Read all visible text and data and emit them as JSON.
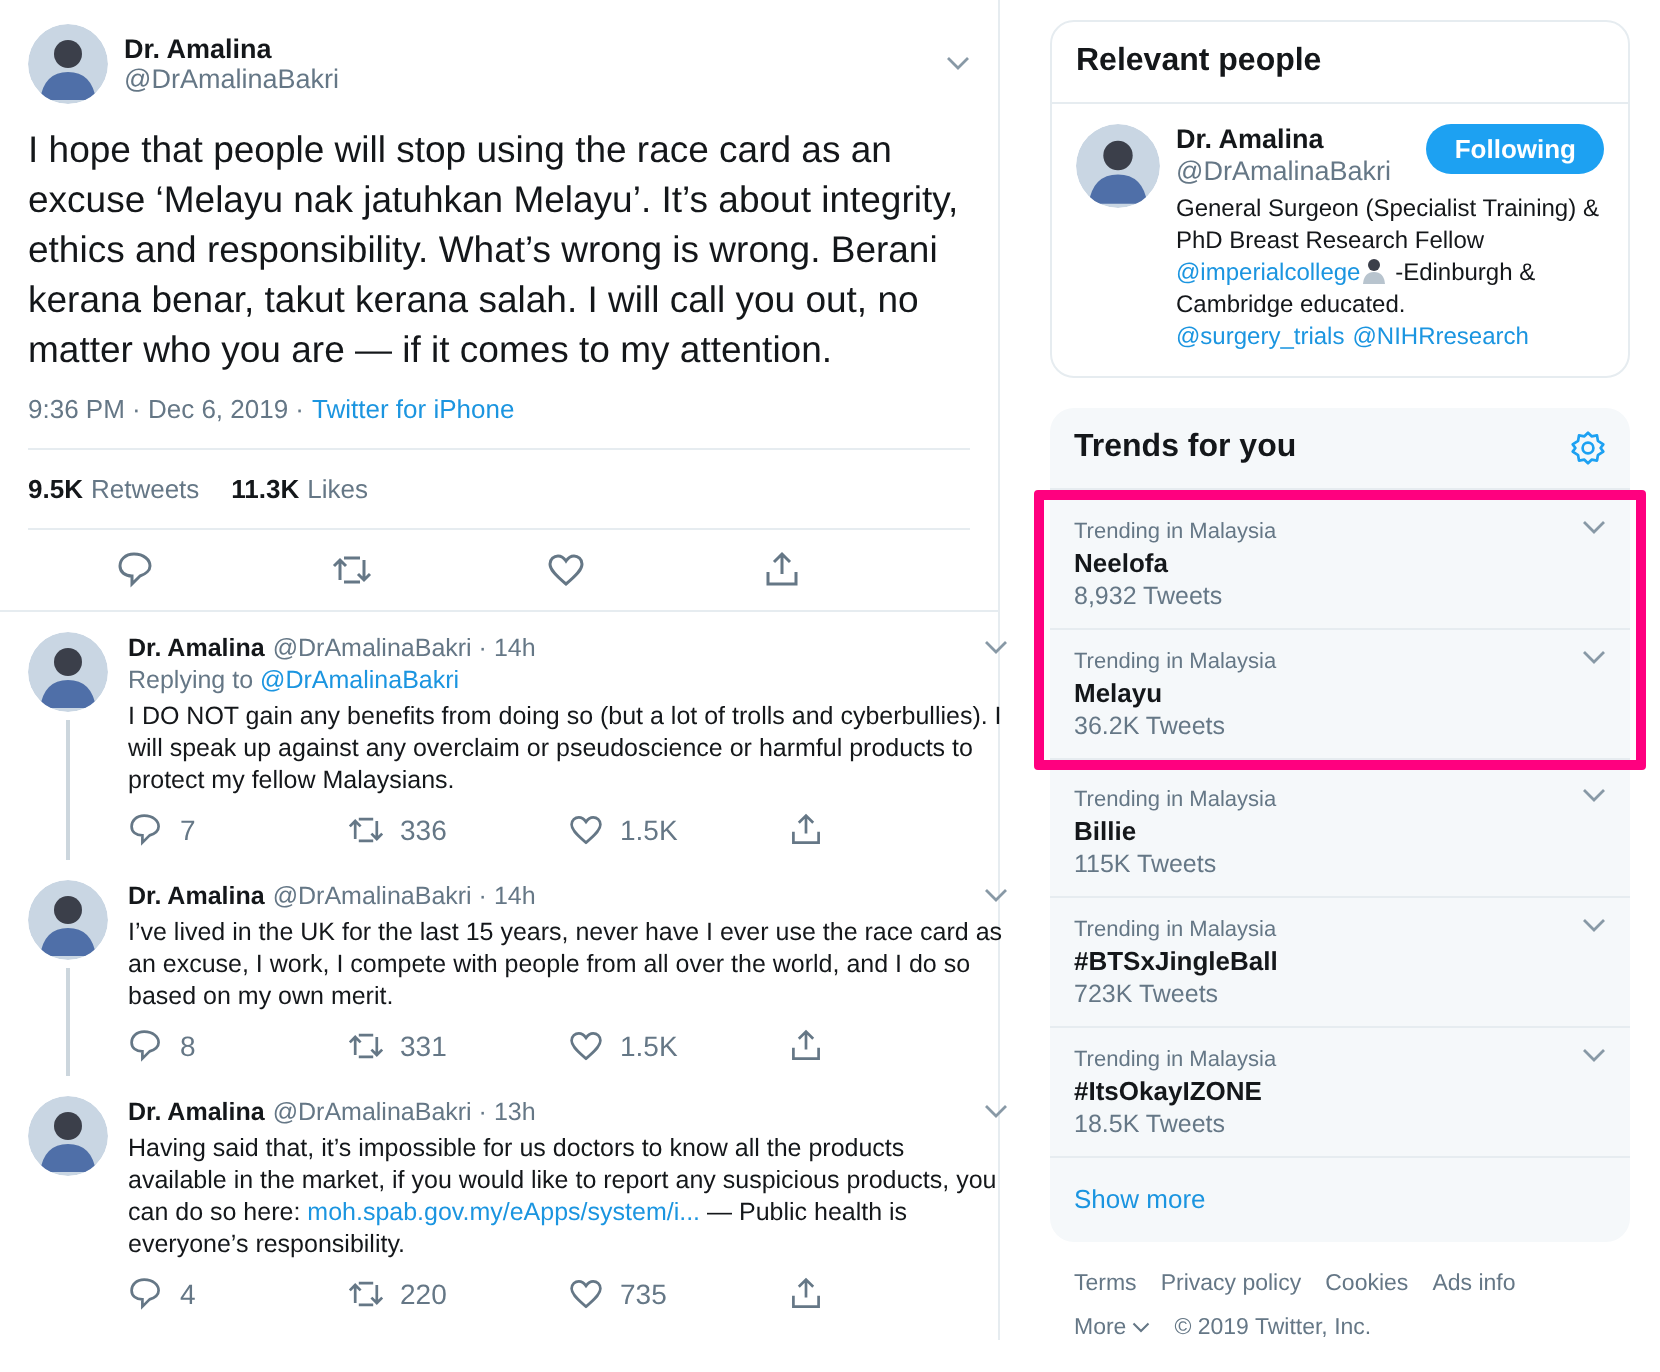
{
  "tweet": {
    "name": "Dr. Amalina",
    "handle": "@DrAmalinaBakri",
    "text": "I hope that people will stop using the race card as an excuse ‘Melayu nak jatuhkan Melayu’. It’s about integrity, ethics and responsibility. What’s wrong is wrong. Berani kerana benar, takut kerana salah. I will call you out, no matter who you are — if it comes to my attention.",
    "time": "9:36 PM · Dec 6, 2019 ·",
    "source": "Twitter for iPhone",
    "retweets": "9.5K",
    "retweets_label": "Retweets",
    "likes": "11.3K",
    "likes_label": "Likes"
  },
  "replies": [
    {
      "name": "Dr. Amalina",
      "handle": "@DrAmalinaBakri · 14h",
      "replying_prefix": "Replying to",
      "replying_to": "@DrAmalinaBakri",
      "connected": true,
      "parts": [
        {
          "kind": "text",
          "text": "I DO NOT gain any benefits from doing so (but a lot of trolls and cyberbullies). I will speak up against any overclaim or pseudoscience or harmful products to protect my fellow Malaysians."
        }
      ],
      "replies": "7",
      "retweets": "336",
      "likes": "1.5K"
    },
    {
      "name": "Dr. Amalina",
      "handle": "@DrAmalinaBakri · 14h",
      "connected": true,
      "parts": [
        {
          "kind": "text",
          "text": "I’ve lived in the UK for the last 15 years, never have I ever use the race card as an excuse, I work, I compete with people from all over the world, and I do so based on my own merit."
        }
      ],
      "replies": "8",
      "retweets": "331",
      "likes": "1.5K"
    },
    {
      "name": "Dr. Amalina",
      "handle": "@DrAmalinaBakri · 13h",
      "connected": false,
      "parts": [
        {
          "kind": "text",
          "text": "Having said that, it’s impossible for us doctors to know all the products available in the market, if you would like to report any suspicious products, you can do so here: "
        },
        {
          "kind": "link",
          "text": "moh.spab.gov.my/eApps/system/i..."
        },
        {
          "kind": "text",
          "text": " — Public health is everyone’s responsibility."
        }
      ],
      "replies": "4",
      "retweets": "220",
      "likes": "735"
    }
  ],
  "relevant_people": {
    "title": "Relevant people",
    "name": "Dr. Amalina",
    "handle": "@DrAmalinaBakri",
    "button": "Following",
    "bio": [
      {
        "kind": "text",
        "text": "General Surgeon (Specialist Training) & PhD Breast Research Fellow "
      },
      {
        "kind": "link",
        "text": "@imperialcollege"
      },
      {
        "kind": "emoji"
      },
      {
        "kind": "text",
        "text": " -Edinburgh & Cambridge educated. "
      },
      {
        "kind": "link",
        "text": "@surgery_trials"
      },
      {
        "kind": "link",
        "text": "@NIHRresearch"
      }
    ]
  },
  "trends": {
    "title": "Trends for you",
    "items": [
      {
        "context": "Trending in Malaysia",
        "topic": "Neelofa",
        "count": "8,932 Tweets",
        "highlighted": true
      },
      {
        "context": "Trending in Malaysia",
        "topic": "Melayu",
        "count": "36.2K Tweets",
        "highlighted": true
      },
      {
        "context": "Trending in Malaysia",
        "topic": "Billie",
        "count": "115K Tweets",
        "highlighted": false
      },
      {
        "context": "Trending in Malaysia",
        "topic": "#BTSxJingleBall",
        "count": "723K Tweets",
        "highlighted": false
      },
      {
        "context": "Trending in Malaysia",
        "topic": "#ItsOkayIZONE",
        "count": "18.5K Tweets",
        "highlighted": false
      }
    ],
    "show_more": "Show more"
  },
  "footer": {
    "links": [
      "Terms",
      "Privacy policy",
      "Cookies",
      "Ads info"
    ],
    "more": "More",
    "copyright": "© 2019 Twitter, Inc."
  }
}
